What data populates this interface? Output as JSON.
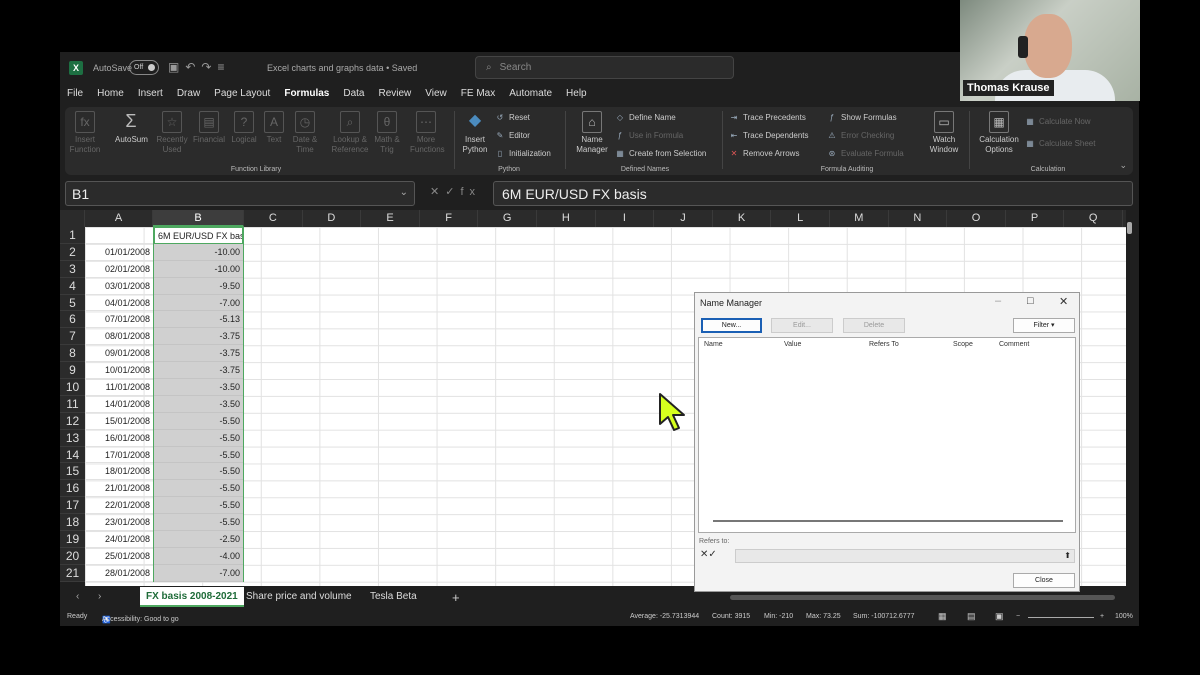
{
  "titlebar": {
    "autosave_label": "AutoSave",
    "autosave_state": "Off",
    "doc_title": "Excel charts and graphs data • Saved",
    "search_placeholder": "Search"
  },
  "menu_tabs": [
    "File",
    "Home",
    "Insert",
    "Draw",
    "Page Layout",
    "Formulas",
    "Data",
    "Review",
    "View",
    "FE Max",
    "Automate",
    "Help"
  ],
  "active_tab": "Formulas",
  "ribbon": {
    "function_library": {
      "label": "Function Library",
      "insert_function": "Insert Function",
      "autosum": "AutoSum",
      "recently_used": "Recently Used",
      "financial": "Financial",
      "logical": "Logical",
      "text": "Text",
      "date_time": "Date & Time",
      "lookup": "Lookup & Reference",
      "math": "Math & Trig",
      "more": "More Functions"
    },
    "python": {
      "label": "Python",
      "insert_python": "Insert Python",
      "reset": "Reset",
      "editor": "Editor",
      "initialization": "Initialization"
    },
    "defined_names": {
      "label": "Defined Names",
      "name_manager": "Name Manager",
      "define_name": "Define Name",
      "use_in_formula": "Use in Formula",
      "create_from_selection": "Create from Selection"
    },
    "formula_auditing": {
      "label": "Formula Auditing",
      "trace_precedents": "Trace Precedents",
      "trace_dependents": "Trace Dependents",
      "remove_arrows": "Remove Arrows",
      "show_formulas": "Show Formulas",
      "error_checking": "Error Checking",
      "evaluate_formula": "Evaluate Formula",
      "watch_window": "Watch Window"
    },
    "calculation": {
      "label": "Calculation",
      "calc_options": "Calculation Options",
      "calc_now": "Calculate Now",
      "calc_sheet": "Calculate Sheet"
    }
  },
  "formula_bar": {
    "name_box": "B1",
    "formula": "6M EUR/USD FX basis"
  },
  "columns": [
    "A",
    "B",
    "C",
    "D",
    "E",
    "F",
    "G",
    "H",
    "I",
    "J",
    "K",
    "L",
    "M",
    "N",
    "O",
    "P",
    "Q"
  ],
  "selected_column": "B",
  "rows": [
    "1",
    "2",
    "3",
    "4",
    "5",
    "6",
    "7",
    "8",
    "9",
    "10",
    "11",
    "12",
    "13",
    "14",
    "15",
    "16",
    "17",
    "18",
    "19",
    "20",
    "21"
  ],
  "cells": {
    "B1": "6M EUR/USD FX basis",
    "data": [
      [
        "01/01/2008",
        "-10.00"
      ],
      [
        "02/01/2008",
        "-10.00"
      ],
      [
        "03/01/2008",
        "-9.50"
      ],
      [
        "04/01/2008",
        "-7.00"
      ],
      [
        "07/01/2008",
        "-5.13"
      ],
      [
        "08/01/2008",
        "-3.75"
      ],
      [
        "09/01/2008",
        "-3.75"
      ],
      [
        "10/01/2008",
        "-3.75"
      ],
      [
        "11/01/2008",
        "-3.50"
      ],
      [
        "14/01/2008",
        "-3.50"
      ],
      [
        "15/01/2008",
        "-5.50"
      ],
      [
        "16/01/2008",
        "-5.50"
      ],
      [
        "17/01/2008",
        "-5.50"
      ],
      [
        "18/01/2008",
        "-5.50"
      ],
      [
        "21/01/2008",
        "-5.50"
      ],
      [
        "22/01/2008",
        "-5.50"
      ],
      [
        "23/01/2008",
        "-5.50"
      ],
      [
        "24/01/2008",
        "-2.50"
      ],
      [
        "25/01/2008",
        "-4.00"
      ],
      [
        "28/01/2008",
        "-7.00"
      ]
    ]
  },
  "sheet_tabs": [
    "FX basis 2008-2021",
    "Share price and volume",
    "Tesla Beta"
  ],
  "active_sheet": "FX basis 2008-2021",
  "status": {
    "ready": "Ready",
    "accessibility": "Accessibility: Good to go",
    "average": "Average: -25.7313944",
    "count": "Count: 3915",
    "min": "Min: -210",
    "max": "Max: 73.25",
    "sum": "Sum: -100712.6777",
    "zoom": "100%"
  },
  "name_manager": {
    "title": "Name Manager",
    "new_btn": "New...",
    "edit_btn": "Edit...",
    "delete_btn": "Delete",
    "filter_btn": "Filter",
    "col_name": "Name",
    "col_value": "Value",
    "col_refers": "Refers To",
    "col_scope": "Scope",
    "col_comment": "Comment",
    "refers_to_label": "Refers to:",
    "close_btn": "Close"
  },
  "webcam": {
    "presenter_name": "Thomas Krause"
  },
  "colors": {
    "excel_green": "#4ea860",
    "selection_fill": "#d0d0d0"
  }
}
